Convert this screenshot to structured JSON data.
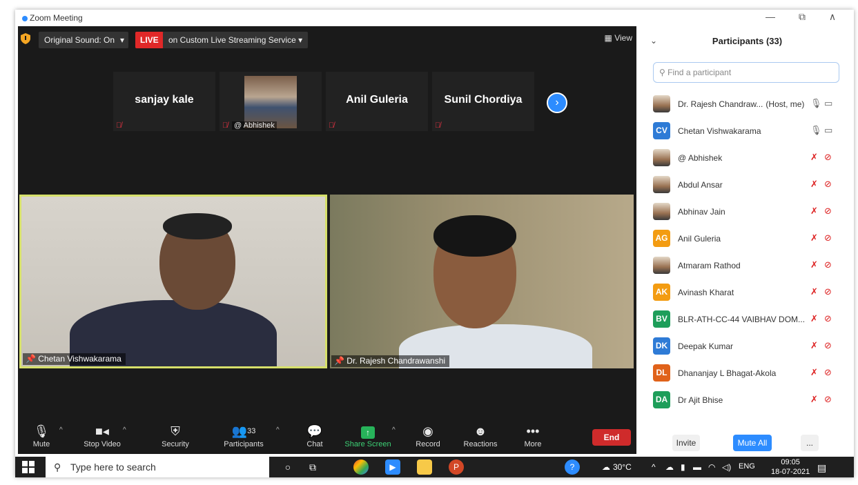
{
  "window": {
    "title": "Zoom Meeting",
    "controls": {
      "minimize": "—",
      "restore": "⧉",
      "close": "∧"
    }
  },
  "top_bar": {
    "original_sound": "Original Sound: On",
    "live_badge": "LIVE",
    "streaming": "on Custom Live Streaming Service",
    "view": "View"
  },
  "thumbnails": [
    {
      "name": "sanjay kale",
      "tag": ""
    },
    {
      "name": "",
      "tag": "@ Abhishek"
    },
    {
      "name": "Anil Guleria",
      "tag": ""
    },
    {
      "name": "Sunil Chordiya",
      "tag": ""
    }
  ],
  "videos": {
    "left_label": "Chetan Vishwakarama",
    "right_label": "Dr. Rajesh Chandrawanshi"
  },
  "toolbar": {
    "mute": "Mute",
    "stop_video": "Stop Video",
    "security": "Security",
    "participants": "Participants",
    "participants_count": "33",
    "chat": "Chat",
    "share_screen": "Share Screen",
    "record": "Record",
    "reactions": "Reactions",
    "more": "More",
    "end": "End"
  },
  "panel": {
    "title": "Participants (33)",
    "search_placeholder": "Find a participant",
    "participants": [
      {
        "name": "Dr. Rajesh Chandraw...",
        "role": "(Host, me)",
        "initials": "",
        "color": "",
        "mic_on": true
      },
      {
        "name": "Chetan Vishwakarama",
        "role": "",
        "initials": "CV",
        "color": "#2E7BD6",
        "mic_on": true
      },
      {
        "name": "@ Abhishek",
        "role": "",
        "initials": "",
        "color": "",
        "mic_on": false
      },
      {
        "name": "Abdul Ansar",
        "role": "",
        "initials": "",
        "color": "",
        "mic_on": false
      },
      {
        "name": "Abhinav Jain",
        "role": "",
        "initials": "",
        "color": "",
        "mic_on": false
      },
      {
        "name": "Anil Guleria",
        "role": "",
        "initials": "AG",
        "color": "#F39C12",
        "mic_on": false
      },
      {
        "name": "Atmaram Rathod",
        "role": "",
        "initials": "",
        "color": "",
        "mic_on": false
      },
      {
        "name": "Avinash Kharat",
        "role": "",
        "initials": "AK",
        "color": "#F39C12",
        "mic_on": false
      },
      {
        "name": "BLR-ATH-CC-44 VAIBHAV DOM...",
        "role": "",
        "initials": "BV",
        "color": "#1E9E5A",
        "mic_on": false
      },
      {
        "name": "Deepak Kumar",
        "role": "",
        "initials": "DK",
        "color": "#2E7BD6",
        "mic_on": false
      },
      {
        "name": "Dhananjay L Bhagat-Akola",
        "role": "",
        "initials": "DL",
        "color": "#E0621A",
        "mic_on": false
      },
      {
        "name": "Dr Ajit Bhise",
        "role": "",
        "initials": "DA",
        "color": "#1E9E5A",
        "mic_on": false
      }
    ],
    "invite": "Invite",
    "mute_all": "Mute All",
    "more": "..."
  },
  "taskbar": {
    "search_placeholder": "Type here to search",
    "temperature": "30°C",
    "language": "ENG",
    "time": "09:05",
    "date": "18-07-2021"
  }
}
